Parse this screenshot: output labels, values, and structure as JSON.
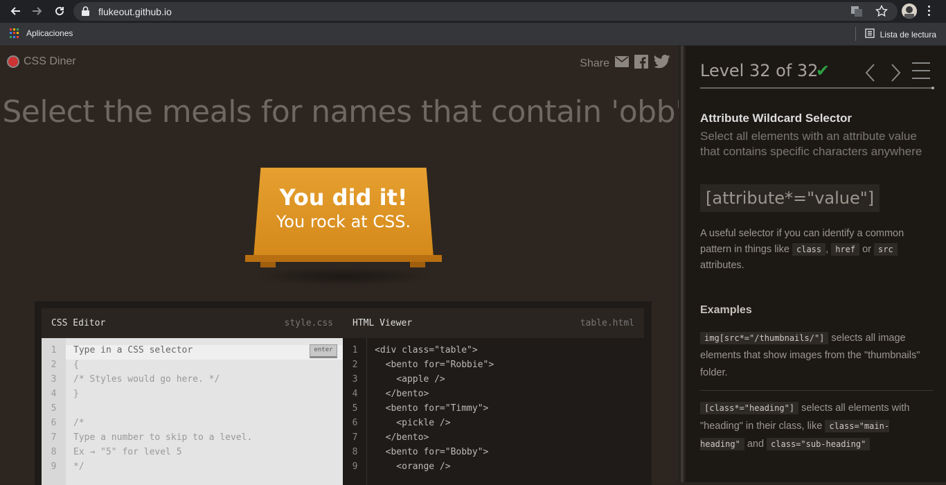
{
  "browser": {
    "url": "flukeout.github.io",
    "bookmarks_apps": "Aplicaciones",
    "reading_list": "Lista de lectura"
  },
  "game": {
    "logo": "CSS Diner",
    "share_label": "Share",
    "order": "Select the meals for names that contain 'obb'",
    "win_title": "You did it!",
    "win_subtitle": "You rock at CSS."
  },
  "editor": {
    "css_title": "CSS Editor",
    "css_file": "style.css",
    "html_title": "HTML Viewer",
    "html_file": "table.html",
    "enter_label": "enter",
    "input_placeholder": "Type in a CSS selector",
    "css_lines": [
      {
        "n": "1",
        "t": ""
      },
      {
        "n": "2",
        "t": "{"
      },
      {
        "n": "3",
        "t": "/* Styles would go here. */"
      },
      {
        "n": "4",
        "t": "}"
      },
      {
        "n": "5",
        "t": ""
      },
      {
        "n": "6",
        "t": "/*"
      },
      {
        "n": "7",
        "t": "Type a number to skip to a level."
      },
      {
        "n": "8",
        "t": "Ex → \"5\" for level 5"
      },
      {
        "n": "9",
        "t": "*/"
      }
    ],
    "html_lines": [
      {
        "n": "1",
        "t": "<div class=\"table\">"
      },
      {
        "n": "2",
        "t": "  <bento for=\"Robbie\">"
      },
      {
        "n": "3",
        "t": "    <apple />"
      },
      {
        "n": "4",
        "t": "  </bento>"
      },
      {
        "n": "5",
        "t": "  <bento for=\"Timmy\">"
      },
      {
        "n": "6",
        "t": "    <pickle />"
      },
      {
        "n": "7",
        "t": "  </bento>"
      },
      {
        "n": "8",
        "t": "  <bento for=\"Bobby\">"
      },
      {
        "n": "9",
        "t": "    <orange />"
      }
    ]
  },
  "sidebar": {
    "level_title": "Level 32 of 32",
    "selector_name": "Attribute Wildcard Selector",
    "selector_title": "Select all elements with an attribute value that contains specific characters anywhere",
    "syntax": "[attribute*=\"value\"]",
    "hint_a": "A useful selector if you can identify a common pattern in things like ",
    "hint_code_1": "class",
    "hint_b": ", ",
    "hint_code_2": "href",
    "hint_c": " or ",
    "hint_code_3": "src",
    "hint_d": " attributes.",
    "examples_label": "Examples",
    "ex1_code": "img[src*=\"/thumbnails/\"]",
    "ex1_text": " selects all image elements that show images from the \"thumbnails\" folder.",
    "ex2_code": "[class*=\"heading\"]",
    "ex2_text_a": " selects all elements with \"heading\" in their class, like ",
    "ex2_code_2": "class=\"main-heading\"",
    "ex2_text_b": " and ",
    "ex2_code_3": "class=\"sub-heading\""
  },
  "colors": {
    "check": "#2ea043",
    "table": "#e0981f"
  }
}
